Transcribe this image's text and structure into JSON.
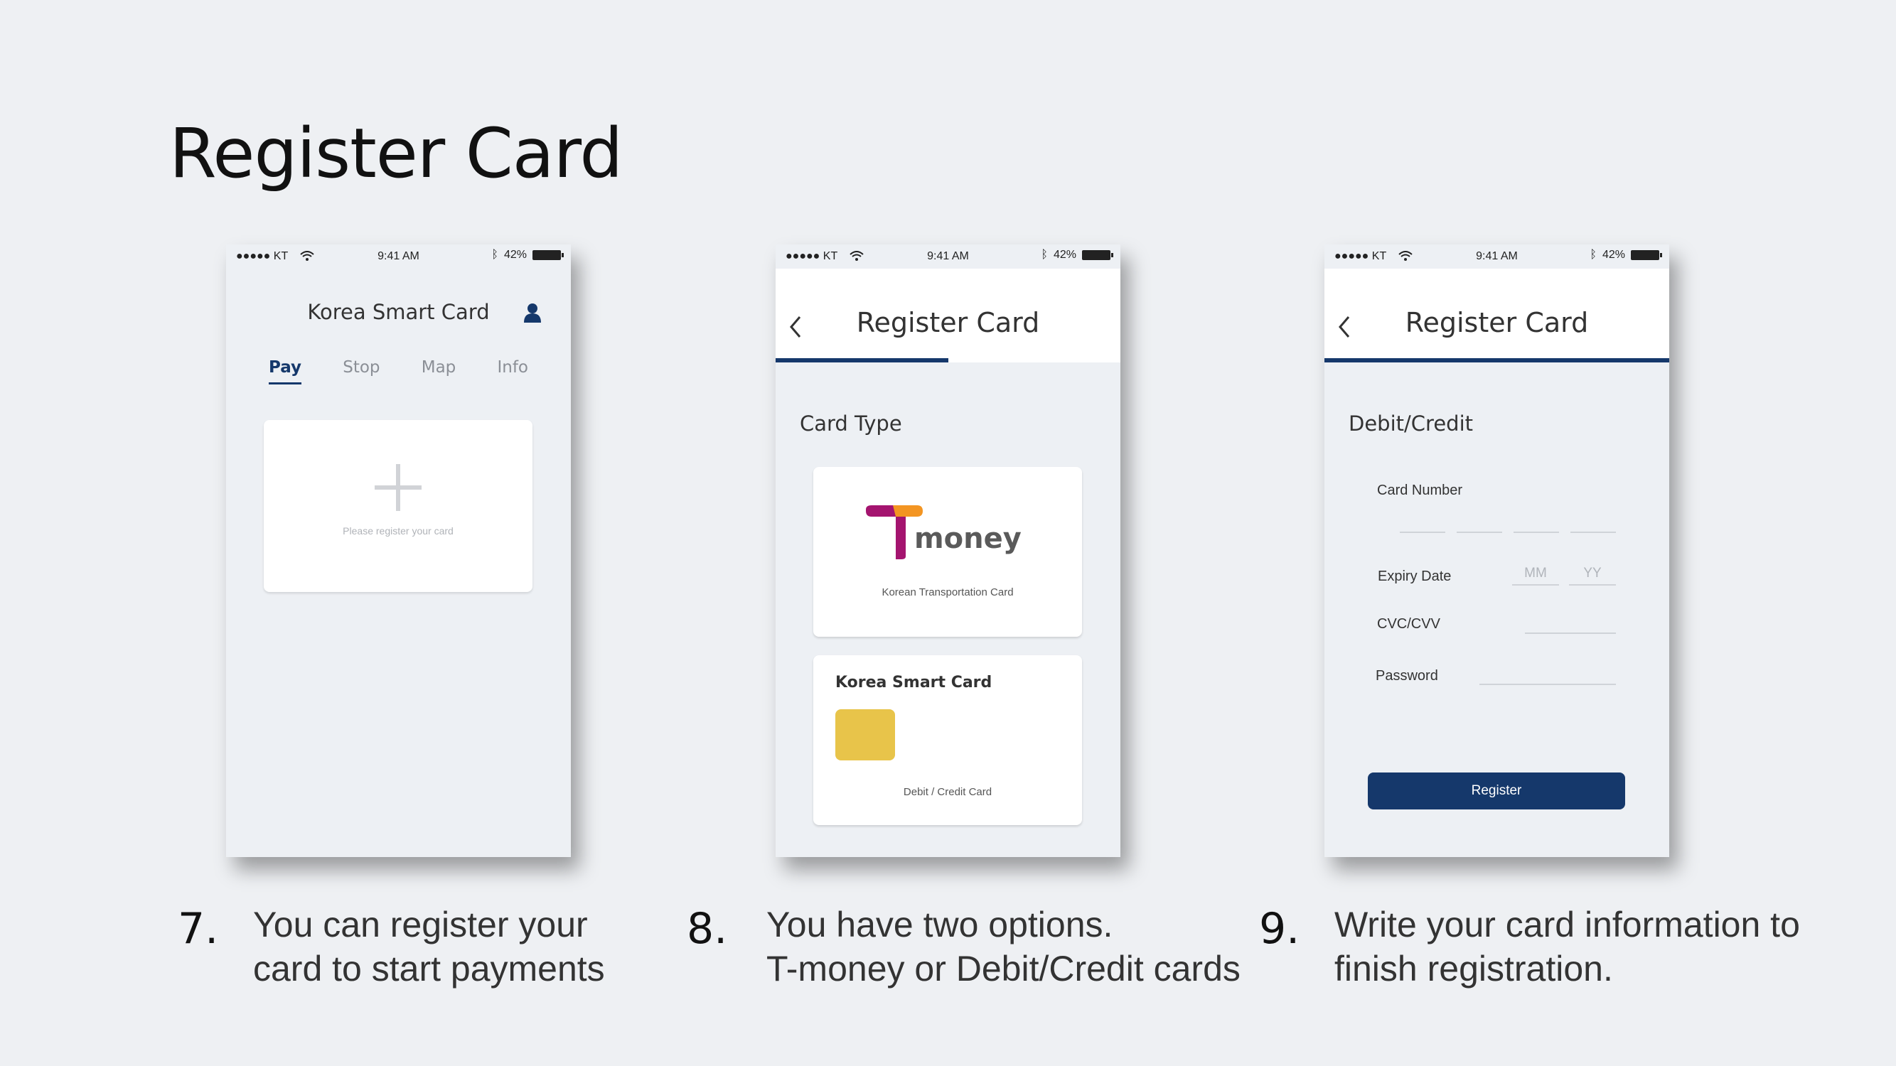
{
  "slide": {
    "title": "Register Card"
  },
  "status_bar": {
    "carrier": "●●●●● KT",
    "time": "9:41 AM",
    "battery": "42%"
  },
  "phone1": {
    "app_title": "Korea Smart Card",
    "tabs": [
      {
        "label": "Pay",
        "active": true
      },
      {
        "label": "Stop"
      },
      {
        "label": "Map"
      },
      {
        "label": "Info"
      }
    ],
    "register_hint": "Please register your card"
  },
  "phone2": {
    "title": "Register Card",
    "section": "Card Type",
    "tmoney_caption": "Korean Transportation Card",
    "ksc_name": "Korea Smart Card",
    "ksc_caption": "Debit / Credit Card",
    "progress_fraction": 0.5
  },
  "phone3": {
    "title": "Register Card",
    "section": "Debit/Credit",
    "card_number_label": "Card Number",
    "expiry_label": "Expiry Date",
    "mm_placeholder": "MM",
    "yy_placeholder": "YY",
    "cvc_label": "CVC/CVV",
    "password_label": "Password",
    "register_button": "Register",
    "progress_fraction": 1.0
  },
  "steps": [
    {
      "num": "7.",
      "lines": [
        "You can register your",
        "card to start payments"
      ]
    },
    {
      "num": "8.",
      "lines": [
        "You have two options.",
        "T-money or Debit/Credit cards"
      ]
    },
    {
      "num": "9.",
      "lines": [
        "Write your card information to",
        "finish registration."
      ]
    }
  ],
  "colors": {
    "primary": "#15386b",
    "chip": "#e8c44a",
    "tmoney_magenta": "#a4146f",
    "tmoney_orange": "#f39522",
    "background": "#eef0f3"
  },
  "icons": [
    "wifi-icon",
    "bluetooth-icon",
    "battery-icon",
    "user-icon",
    "back-icon",
    "plus-icon"
  ]
}
